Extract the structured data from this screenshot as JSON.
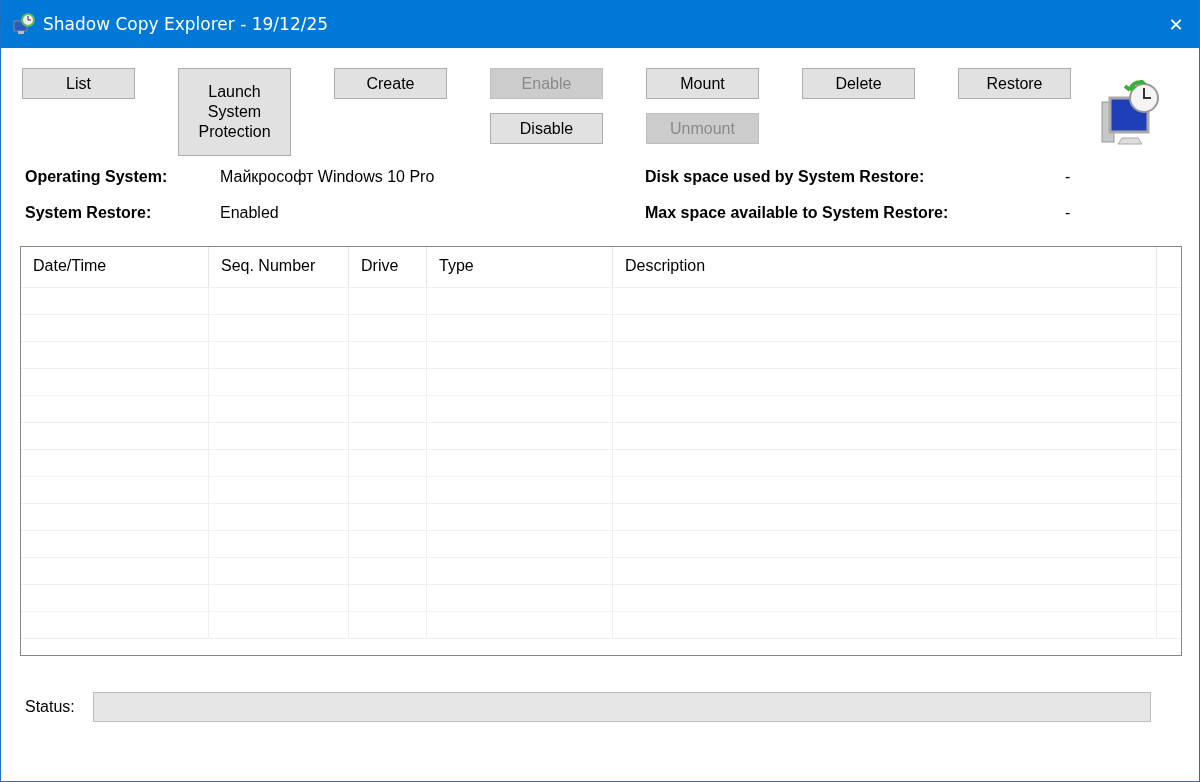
{
  "window": {
    "title": "Shadow Copy Explorer - 19/12/25",
    "close": "✕"
  },
  "toolbar": [
    {
      "buttons": [
        {
          "label": "List",
          "kind": "normal",
          "disabled": false
        }
      ]
    },
    {
      "buttons": [
        {
          "label": "Launch System Protection",
          "kind": "tall",
          "disabled": false
        }
      ]
    },
    {
      "buttons": [
        {
          "label": "Create",
          "kind": "normal",
          "disabled": false
        }
      ]
    },
    {
      "buttons": [
        {
          "label": "Enable",
          "kind": "normal",
          "disabled": true
        },
        {
          "label": "Disable",
          "kind": "normal",
          "disabled": false
        }
      ]
    },
    {
      "buttons": [
        {
          "label": "Mount",
          "kind": "normal",
          "disabled": false
        },
        {
          "label": "Unmount",
          "kind": "normal",
          "disabled": true
        }
      ]
    },
    {
      "buttons": [
        {
          "label": "Delete",
          "kind": "normal",
          "disabled": false
        }
      ]
    },
    {
      "buttons": [
        {
          "label": "Restore",
          "kind": "normal",
          "disabled": false
        }
      ]
    }
  ],
  "info_left": [
    {
      "label": "Operating System:",
      "value": "Майкрософт Windows 10 Pro"
    },
    {
      "label": "System Restore:",
      "value": "Enabled"
    }
  ],
  "info_right": [
    {
      "label": "Disk space used by System Restore:",
      "value": "-"
    },
    {
      "label": "Max space available to System Restore:",
      "value": "-"
    }
  ],
  "table": {
    "columns": [
      "Date/Time",
      "Seq. Number",
      "Drive",
      "Type",
      "Description"
    ]
  },
  "status_bar": {
    "label": "Status:"
  }
}
